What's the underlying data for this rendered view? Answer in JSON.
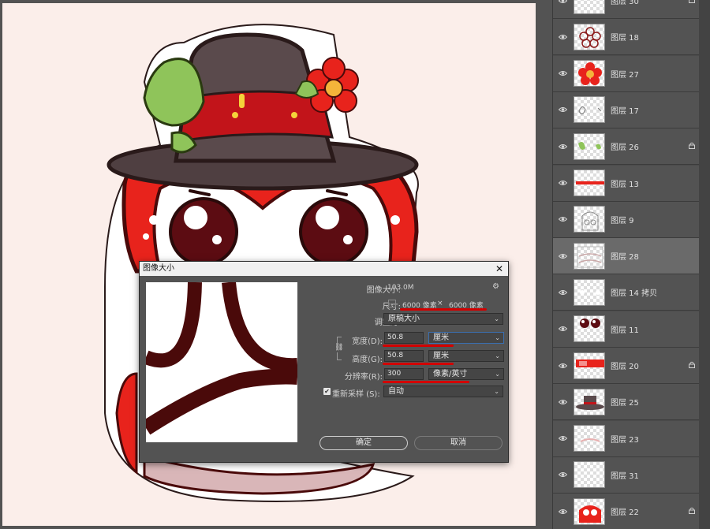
{
  "layers": [
    {
      "name": "图层 30",
      "locked": true,
      "selected": false,
      "thumb": "blank"
    },
    {
      "name": "图层 18",
      "locked": false,
      "selected": false,
      "thumb": "flower-outline"
    },
    {
      "name": "图层 27",
      "locked": false,
      "selected": false,
      "thumb": "flower-red"
    },
    {
      "name": "图层 17",
      "locked": false,
      "selected": false,
      "thumb": "leaf-outline"
    },
    {
      "name": "图层 26",
      "locked": true,
      "selected": false,
      "thumb": "leaf-green"
    },
    {
      "name": "图层 13",
      "locked": false,
      "selected": false,
      "thumb": "band"
    },
    {
      "name": "图层 9",
      "locked": false,
      "selected": false,
      "thumb": "sketch"
    },
    {
      "name": "图层 28",
      "locked": false,
      "selected": true,
      "thumb": "body-sketch"
    },
    {
      "name": "图层 14 拷贝",
      "locked": false,
      "selected": false,
      "thumb": "highlights"
    },
    {
      "name": "图层 11",
      "locked": false,
      "selected": false,
      "thumb": "eyes"
    },
    {
      "name": "图层 20",
      "locked": true,
      "selected": false,
      "thumb": "red-strip"
    },
    {
      "name": "图层 25",
      "locked": false,
      "selected": false,
      "thumb": "hat"
    },
    {
      "name": "图层 23",
      "locked": false,
      "selected": false,
      "thumb": "pink-arcs"
    },
    {
      "name": "图层 31",
      "locked": false,
      "selected": false,
      "thumb": "blank"
    },
    {
      "name": "图层 22",
      "locked": true,
      "selected": false,
      "thumb": "red-body"
    }
  ],
  "dialog": {
    "title": "图像大小",
    "close": "✕",
    "image_size_label": "图像大小:",
    "image_size_value": "103.0M",
    "dimensions_label": "尺寸:",
    "dimensions_width": "6000 像素",
    "dimensions_times": "×",
    "dimensions_height": "6000 像素",
    "resize_label": "调整为:",
    "resize_value": "原稿大小",
    "width_label": "宽度(D):",
    "width_value": "50.8",
    "width_unit": "厘米",
    "height_label": "高度(G):",
    "height_value": "50.8",
    "height_unit": "厘米",
    "resolution_label": "分辨率(R):",
    "resolution_value": "300",
    "resolution_unit": "像素/英寸",
    "resample_label": "重新采样 (S):",
    "resample_checked": true,
    "resample_value": "自动",
    "ok": "确定",
    "cancel": "取消"
  },
  "colors": {
    "canvas_bg": "#fbeeea",
    "mascot_red": "#e8231c",
    "hat": "#5a4a4c",
    "outline": "#4a0a0a",
    "annotation_red": "#d30000"
  }
}
